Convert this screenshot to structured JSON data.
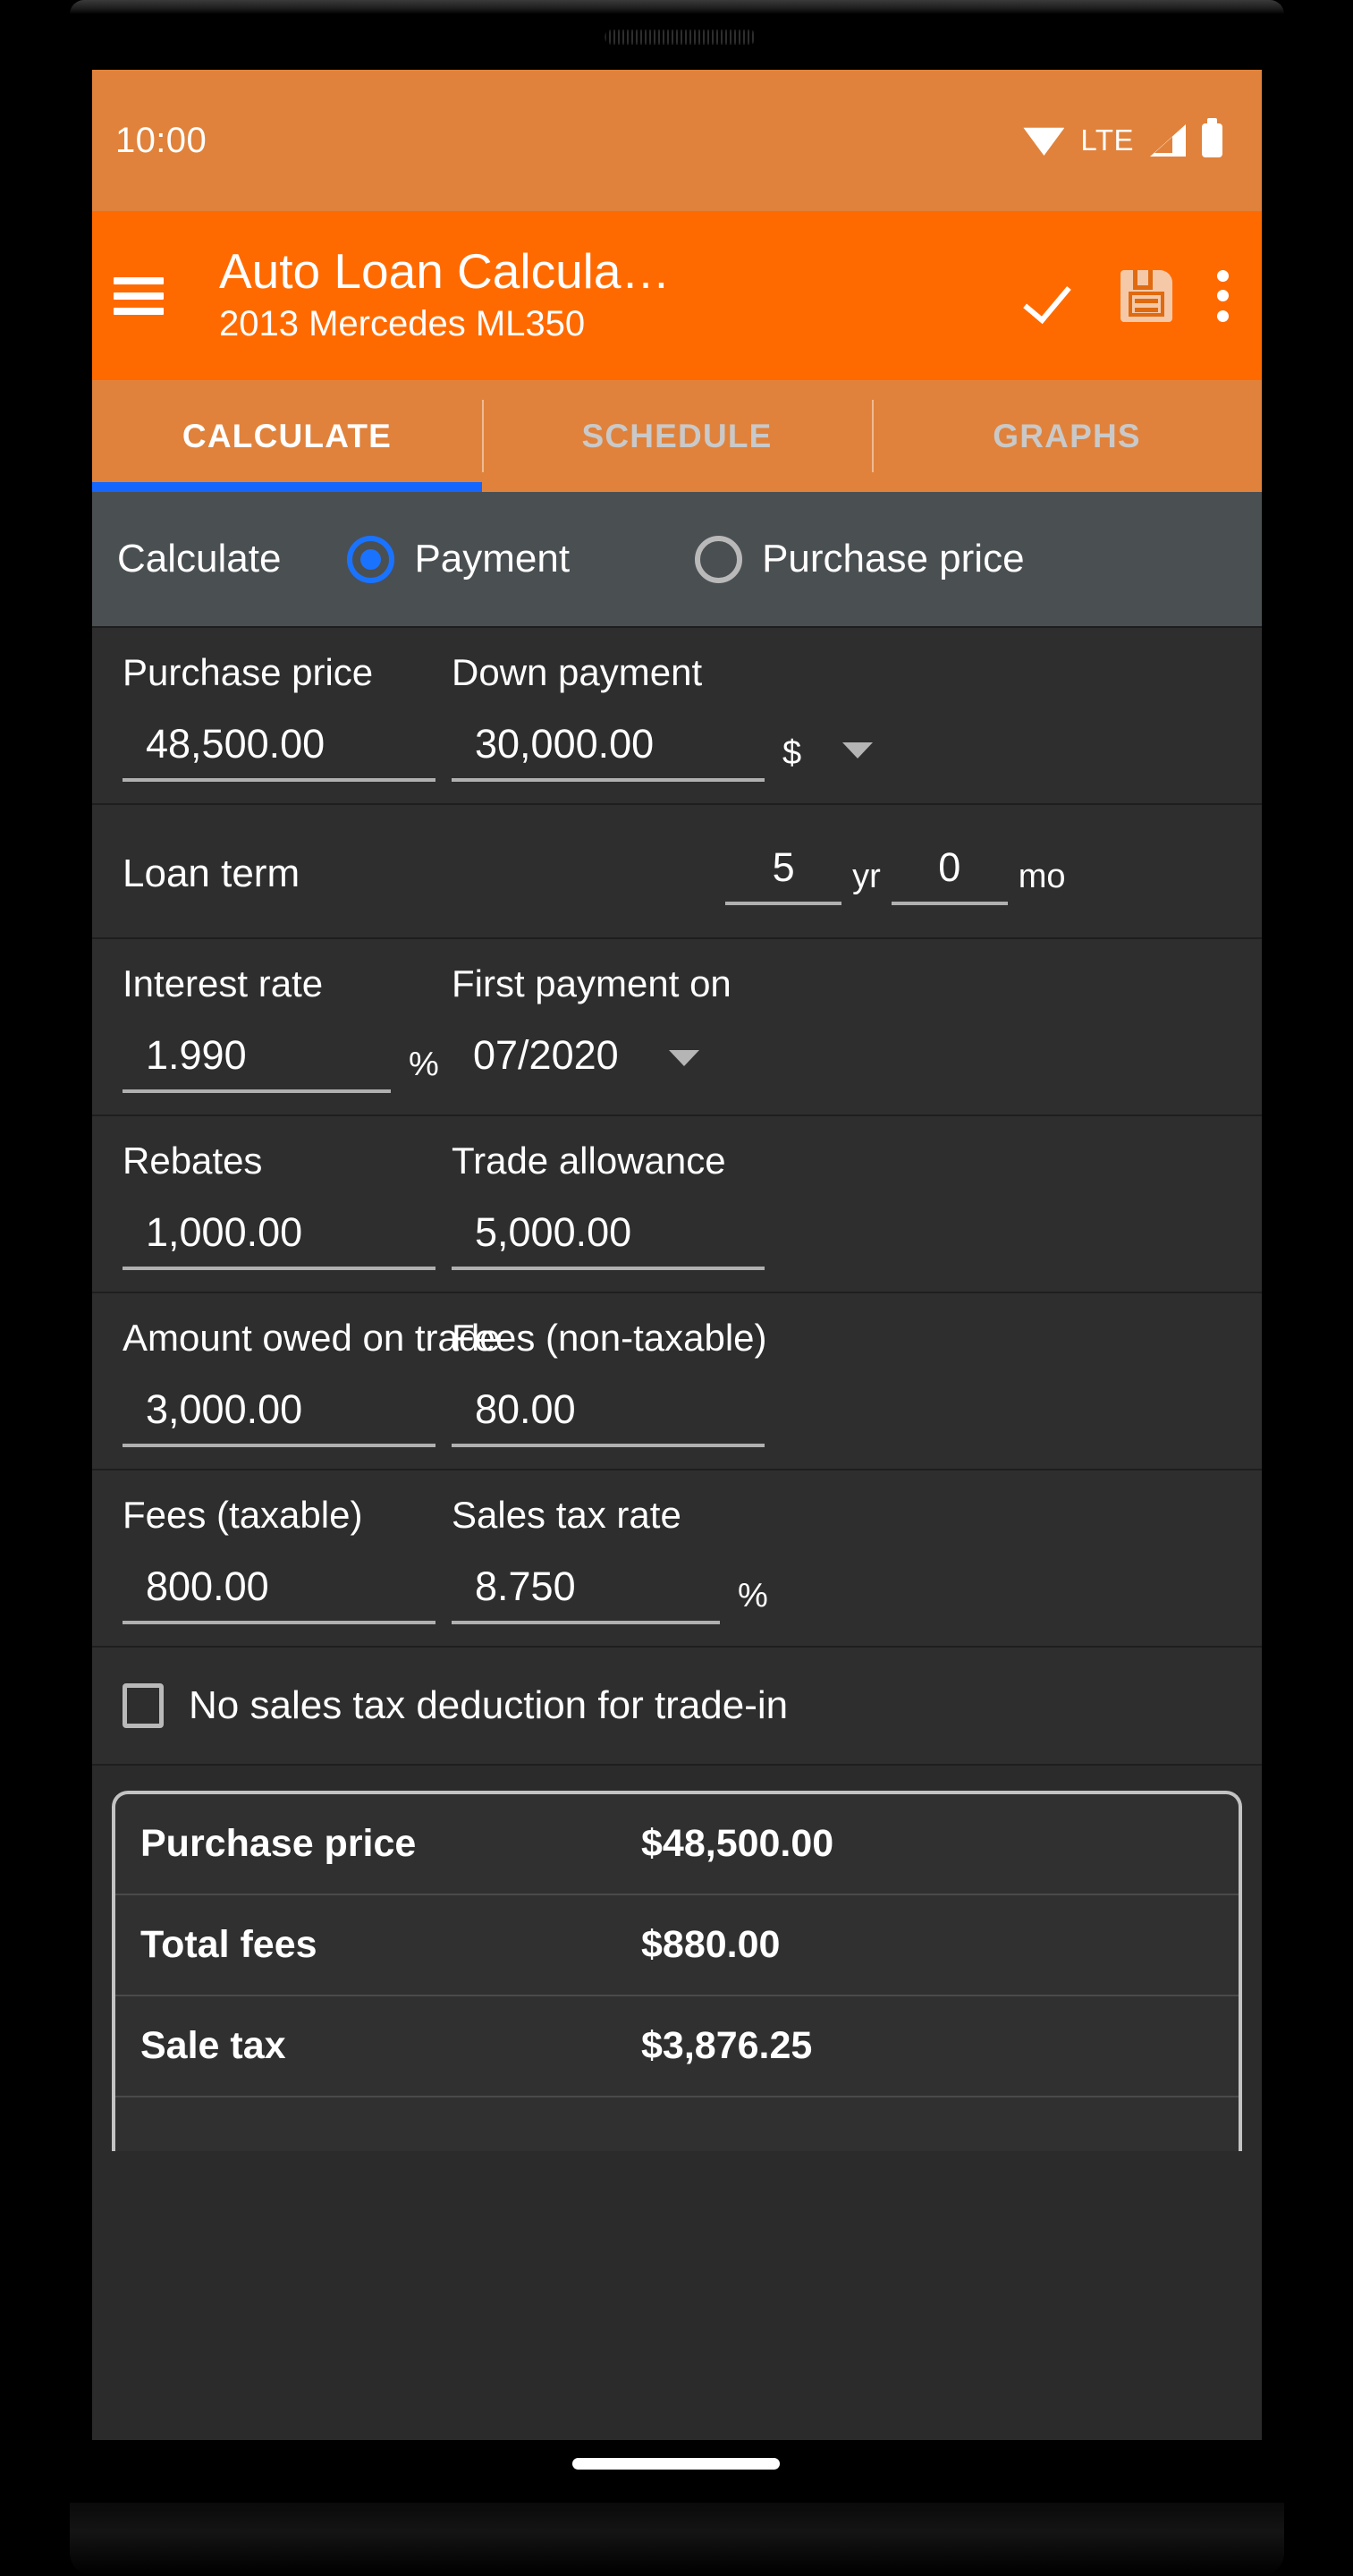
{
  "status_bar": {
    "time": "10:00",
    "icons": [
      "wifi-icon",
      "lte-label",
      "signal-icon",
      "battery-icon"
    ],
    "network_label": "LTE",
    "background": "#e0823b"
  },
  "app_bar": {
    "menu_icon": "hamburger-menu-icon",
    "title": "Auto Loan Calcula…",
    "subtitle": "2013 Mercedes ML350",
    "actions": [
      {
        "name": "confirm-check-icon",
        "glyph": "check"
      },
      {
        "name": "save-icon",
        "glyph": "floppy-disk"
      },
      {
        "name": "overflow-menu-icon",
        "glyph": "three-dots-vertical"
      }
    ],
    "background": "#ff6a00"
  },
  "tabs": {
    "items": [
      {
        "label": "CALCULATE",
        "active": true
      },
      {
        "label": "SCHEDULE",
        "active": false
      },
      {
        "label": "GRAPHS",
        "active": false
      }
    ],
    "indicator_color": "#1565ff"
  },
  "calc_mode": {
    "label": "Calculate",
    "options": [
      {
        "label": "Payment",
        "selected": true
      },
      {
        "label": "Purchase price",
        "selected": false
      }
    ],
    "selected_color": "#1a73ff"
  },
  "form": {
    "purchase_price": {
      "label": "Purchase price",
      "value": "48,500.00"
    },
    "down_payment": {
      "label": "Down payment",
      "value": "30,000.00",
      "unit": "$",
      "unit_caret": "chevron-down-icon"
    },
    "loan_term": {
      "label": "Loan term",
      "years": "5",
      "years_unit": "yr",
      "months": "0",
      "months_unit": "mo"
    },
    "interest_rate": {
      "label": "Interest rate",
      "value": "1.990",
      "unit": "%"
    },
    "first_payment": {
      "label": "First payment on",
      "value": "07/2020"
    },
    "rebates": {
      "label": "Rebates",
      "value": "1,000.00"
    },
    "trade_allowance": {
      "label": "Trade allowance",
      "value": "5,000.00"
    },
    "amount_owed_trade": {
      "label": "Amount owed on trade",
      "value": "3,000.00"
    },
    "fees_non_taxable": {
      "label": "Fees (non-taxable)",
      "value": "80.00"
    },
    "fees_taxable": {
      "label": "Fees (taxable)",
      "value": "800.00"
    },
    "sales_tax_rate": {
      "label": "Sales tax rate",
      "value": "8.750",
      "unit": "%"
    },
    "no_tax_deduction": {
      "label": "No sales tax deduction for trade-in",
      "checked": false
    }
  },
  "summary": {
    "rows": [
      {
        "label": "Purchase price",
        "value": "$48,500.00"
      },
      {
        "label": "Total fees",
        "value": "$880.00"
      },
      {
        "label": "Sale tax",
        "value": "$3,876.25"
      }
    ]
  }
}
